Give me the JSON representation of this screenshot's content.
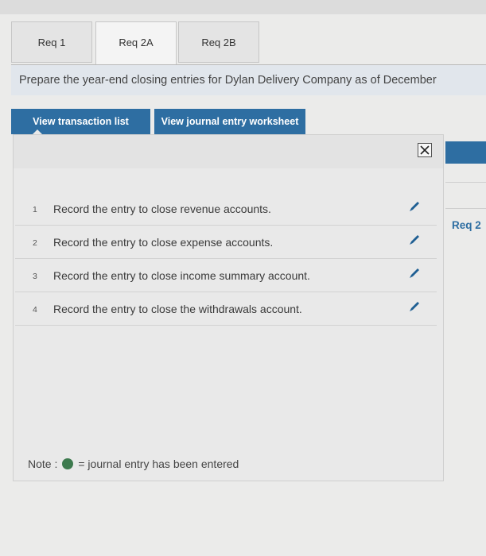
{
  "tabs": [
    {
      "label": "Req 1"
    },
    {
      "label": "Req 2A"
    },
    {
      "label": "Req 2B"
    }
  ],
  "instruction": "Prepare the year-end closing entries for Dylan Delivery Company as of December",
  "buttons": {
    "view_transaction_list": "View transaction list",
    "view_journal_entry_worksheet": "View journal entry worksheet"
  },
  "entries": [
    {
      "num": "1",
      "text": "Record the entry to close revenue accounts."
    },
    {
      "num": "2",
      "text": "Record the entry to close expense accounts."
    },
    {
      "num": "3",
      "text": "Record the entry to close income summary account."
    },
    {
      "num": "4",
      "text": "Record the entry to close the withdrawals account."
    }
  ],
  "note": {
    "label": "Note :",
    "text": "= journal entry has been entered",
    "dot_color": "#3d7a4e"
  },
  "side_nav": {
    "label": "Req 2"
  },
  "colors": {
    "accent": "#2e6ea2"
  },
  "icons": {
    "close": "close-icon",
    "edit": "pencil-icon"
  }
}
